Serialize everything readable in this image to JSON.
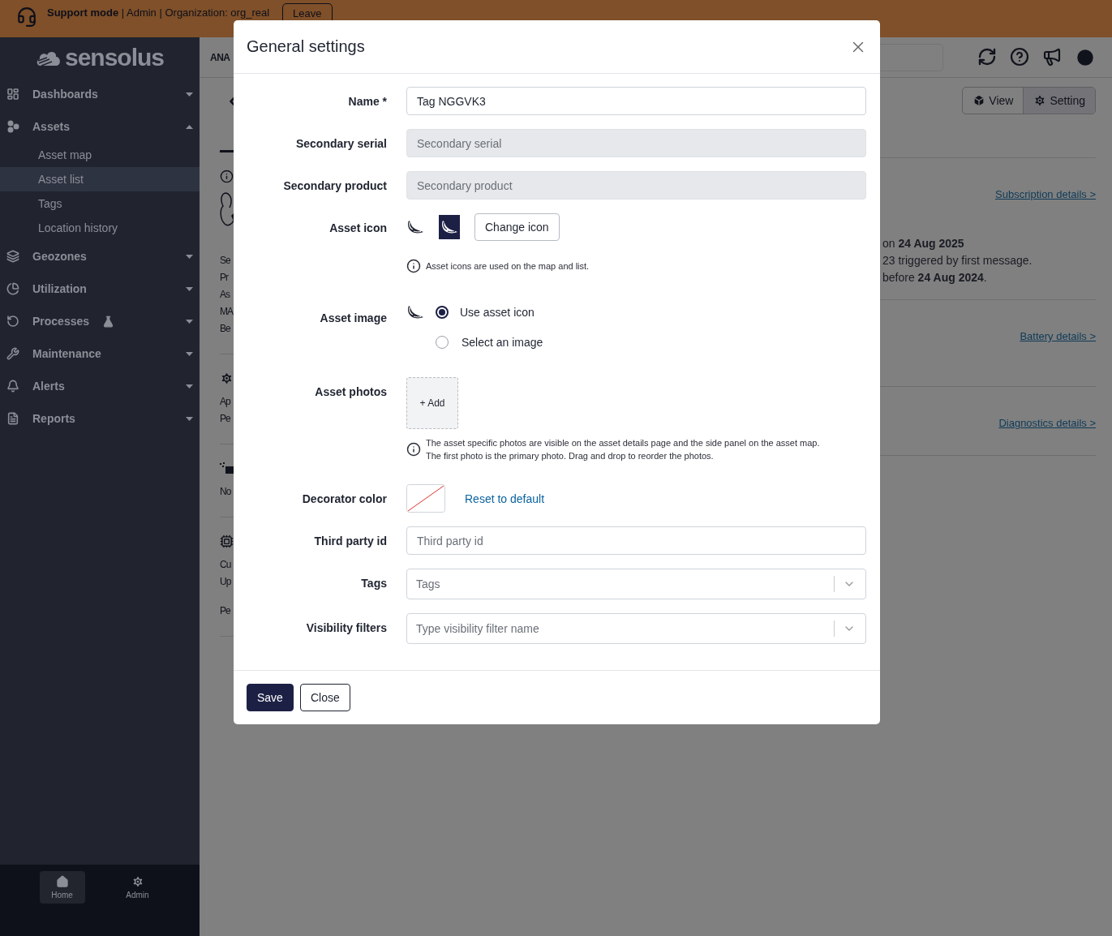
{
  "banner": {
    "mode": "Support mode",
    "details": "| Admin | Organization: org_real",
    "button": "Leave"
  },
  "sidebar": {
    "logo": "sensolus",
    "items": [
      {
        "label": "Dashboards",
        "kind": "dashboards",
        "expanded": false
      },
      {
        "label": "Assets",
        "kind": "assets",
        "expanded": true,
        "children": [
          {
            "label": "Asset map",
            "selected": false
          },
          {
            "label": "Asset list",
            "selected": true
          },
          {
            "label": "Tags",
            "selected": false
          },
          {
            "label": "Location history",
            "selected": false
          }
        ]
      },
      {
        "label": "Geozones",
        "kind": "geozones",
        "expanded": false
      },
      {
        "label": "Utilization",
        "kind": "utilization",
        "expanded": false
      },
      {
        "label": "Processes",
        "kind": "processes",
        "expanded": false,
        "beta": true
      },
      {
        "label": "Maintenance",
        "kind": "maintenance",
        "expanded": false
      },
      {
        "label": "Alerts",
        "kind": "alerts",
        "expanded": false
      },
      {
        "label": "Reports",
        "kind": "reports",
        "expanded": false
      }
    ],
    "bottom_nav": [
      {
        "label": "Home",
        "kind": "home",
        "selected": true
      },
      {
        "label": "Admin",
        "kind": "admin",
        "selected": false
      }
    ]
  },
  "page": {
    "header_title": "ANA",
    "left_sections": [
      {
        "kind": "info",
        "lines": [
          "Se",
          "Pr",
          "As",
          "MA",
          "Be"
        ]
      },
      {
        "kind": "gear",
        "lines": [
          "Ap",
          "Pe"
        ]
      },
      {
        "kind": "pixels",
        "lines": [
          "No"
        ]
      },
      {
        "kind": "chip",
        "lines": [
          "Cu",
          "Up"
        ],
        "note": "Pe"
      }
    ],
    "view_buttons": [
      {
        "label": "View",
        "kind": "view",
        "selected": false
      },
      {
        "label": "Setting",
        "kind": "setting",
        "selected": true
      }
    ],
    "right_sections": [
      {
        "link": "Subscription details >",
        "lines": [
          "on **24 Aug 2025**",
          "23 triggered by first message.",
          "before **24 Aug 2024**."
        ]
      },
      {
        "link": "Battery details >"
      },
      {
        "link": "Diagnostics details >"
      }
    ]
  },
  "modal": {
    "title": "General settings",
    "fields": [
      {
        "kind": "text",
        "label": "Name *",
        "value": "Tag NGGVK3"
      },
      {
        "kind": "disabled",
        "label": "Secondary serial",
        "placeholder": "Secondary serial"
      },
      {
        "kind": "disabled",
        "label": "Secondary product",
        "placeholder": "Secondary product"
      },
      {
        "kind": "icon",
        "label": "Asset icon",
        "button": "Change icon",
        "hint": "Asset icons are used on the map and list."
      },
      {
        "kind": "radios",
        "label": "Asset image",
        "options": [
          {
            "label": "Use asset icon",
            "selected": true
          },
          {
            "label": "Select an image",
            "selected": false
          }
        ]
      },
      {
        "kind": "photos",
        "label": "Asset photos",
        "button": "+ Add",
        "hint_lines": [
          "The asset specific photos are visible on the asset details page and the side panel on the asset map.",
          "The first photo is the primary photo. Drag and drop to reorder the photos."
        ]
      },
      {
        "kind": "color",
        "label": "Decorator color",
        "link": "Reset to default"
      },
      {
        "kind": "text",
        "label": "Third party id",
        "placeholder": "Third party id"
      },
      {
        "kind": "select",
        "label": "Tags",
        "placeholder": "Tags"
      },
      {
        "kind": "select",
        "label": "Visibility filters",
        "placeholder": "Type visibility filter name"
      }
    ],
    "buttons": [
      {
        "label": "Save",
        "kind": "primary"
      },
      {
        "label": "Close",
        "kind": "secondary"
      }
    ]
  }
}
